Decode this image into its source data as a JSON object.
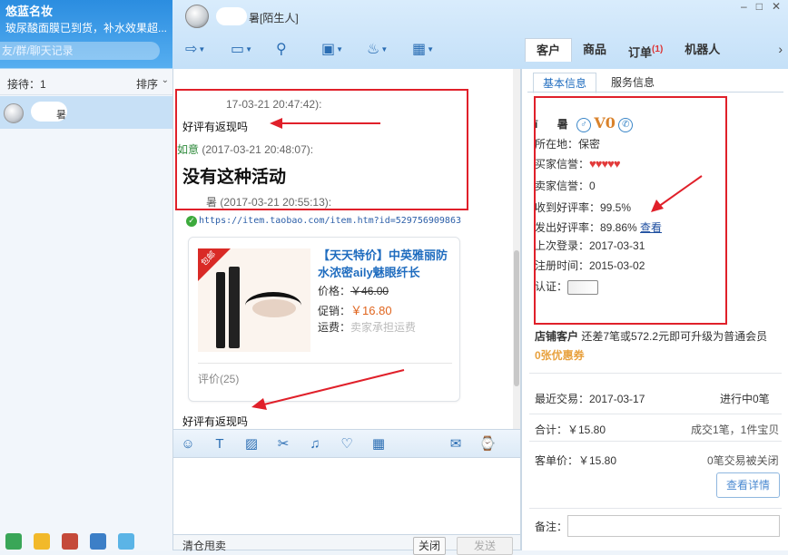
{
  "left": {
    "shop_name": "悠蓝名妆",
    "signature": "玻尿酸面膜已到货，补水效果超...",
    "search_placeholder": "友/群/聊天记录",
    "waiting_label": "接待：1",
    "sort_label": "排序",
    "contact_suffix": "暑"
  },
  "header": {
    "chat_name_suffix": "暑",
    "chat_tag": "[陌生人]"
  },
  "right_tabs": [
    {
      "label": "客户",
      "active": true
    },
    {
      "label": "商品"
    },
    {
      "label": "订单",
      "count": "(1)"
    },
    {
      "label": "机器人"
    }
  ],
  "chat": {
    "msg1_time": "17-03-21 20:47:42):",
    "msg1_text": "好评有返现吗",
    "msg2_sender": "如意",
    "msg2_time": "(2017-03-21 20:48:07):",
    "msg2_text": "没有这种活动",
    "msg3_sender_suffix": "暑",
    "msg3_time": "(2017-03-21 20:55:13):",
    "link": "https://item.taobao.com/item.htm?id=529756909863",
    "card": {
      "corner_tag": "包邮",
      "title": "【天天特价】中英雅丽防水浓密aily魅眼纤长",
      "price_label": "价格：",
      "price": "￥46.00",
      "promo_label": "促销：",
      "promo_price": "￥16.80",
      "ship_label": "运费：",
      "ship_value": "卖家承担运费",
      "review": "评价(25)"
    },
    "msg4_text": "好评有返现吗"
  },
  "input": {
    "clear_label": "清仓甩卖",
    "close_button": "关闭",
    "send_button": "发送"
  },
  "customer": {
    "tabs": [
      "基本信息",
      "服务信息"
    ],
    "level_badge": "V0",
    "location": "所在地：保密",
    "buyer_credit_label": "买家信誉：",
    "seller_credit": "卖家信誉：0",
    "good_rate_received": "收到好评率：99.5%",
    "good_rate_given_label": "发出好评率：89.86%",
    "view_link": "查看",
    "last_login": "上次登录：2017-03-31",
    "register_time": "注册时间：2015-03-02",
    "auth_label": "认证：",
    "shop_customer_label": "店铺客户",
    "shop_customer_text": "还差7笔或572.2元即可升级为普通会员",
    "coupon": "0张优惠券",
    "recent_trade": "最近交易：2017-03-17",
    "in_progress": "进行中0笔",
    "total": "合计：￥15.80",
    "deals": "成交1笔，1件宝贝",
    "unit_price": "客单价：￥15.80",
    "closed_deals": "0笔交易被关闭",
    "detail_button": "查看详情",
    "note_label": "备注："
  },
  "colors": {
    "accent": "#1f6cbf",
    "annotation": "#e0202a",
    "promo": "#e0651e"
  }
}
